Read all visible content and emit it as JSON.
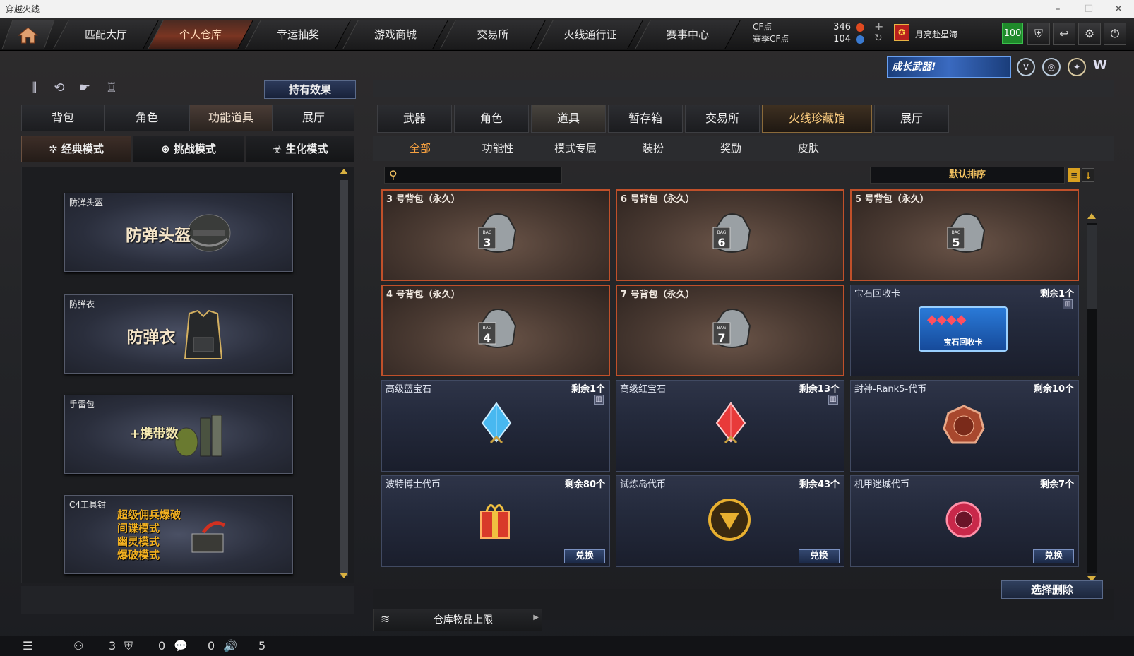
{
  "window": {
    "title": "穿越火线"
  },
  "nav": {
    "tabs": [
      {
        "label": "匹配大厅"
      },
      {
        "label": "个人仓库"
      },
      {
        "label": "幸运抽奖"
      },
      {
        "label": "游戏商城"
      },
      {
        "label": "交易所"
      },
      {
        "label": "火线通行证"
      },
      {
        "label": "赛事中心"
      }
    ],
    "cf_label": "CF点",
    "season_cf_label": "赛季CF点",
    "cf_value": "346",
    "season_cf_value": "104",
    "username": "月亮赴星海-",
    "level": "100"
  },
  "promo": {
    "banner_text": "成长武器!"
  },
  "left": {
    "effects_button": "持有效果",
    "tabs": [
      {
        "label": "背包"
      },
      {
        "label": "角色"
      },
      {
        "label": "功能道具"
      },
      {
        "label": "展厅"
      }
    ],
    "modes": [
      {
        "label": "经典模式"
      },
      {
        "label": "挑战模式"
      },
      {
        "label": "生化模式"
      }
    ],
    "items": [
      {
        "title": "防弹头盔",
        "art_text": "防弹头盔"
      },
      {
        "title": "防弹衣",
        "art_text": "防弹衣"
      },
      {
        "title": "手雷包",
        "art_text": "+携带数"
      },
      {
        "title": "C4工具钳",
        "art_lines": [
          "超级佣兵爆破",
          "间谍模式",
          "幽灵模式",
          "爆破模式"
        ]
      }
    ]
  },
  "right": {
    "tabs": [
      {
        "label": "武器"
      },
      {
        "label": "角色"
      },
      {
        "label": "道具"
      },
      {
        "label": "暂存箱"
      },
      {
        "label": "交易所"
      },
      {
        "label": "火线珍藏馆"
      },
      {
        "label": "展厅"
      }
    ],
    "subtabs": [
      {
        "label": "全部"
      },
      {
        "label": "功能性"
      },
      {
        "label": "模式专属"
      },
      {
        "label": "装扮"
      },
      {
        "label": "奖励"
      },
      {
        "label": "皮肤"
      }
    ],
    "search": {
      "placeholder": ""
    },
    "sort_label": "默认排序",
    "items": [
      {
        "name": "3 号背包（永久）",
        "bag_no": "3"
      },
      {
        "name": "6 号背包（永久）",
        "bag_no": "6"
      },
      {
        "name": "5 号背包（永久）",
        "bag_no": "5"
      },
      {
        "name": "4 号背包（永久）",
        "bag_no": "4"
      },
      {
        "name": "7 号背包（永久）",
        "bag_no": "7"
      },
      {
        "name": "宝石回收卡",
        "count": "剩余1个",
        "art_text": "宝石回收卡"
      },
      {
        "name": "高级蓝宝石",
        "count": "剩余1个"
      },
      {
        "name": "高级红宝石",
        "count": "剩余13个"
      },
      {
        "name": "封神-Rank5-代币",
        "count": "剩余10个"
      },
      {
        "name": "波特博士代币",
        "count": "剩余80个",
        "action": "兑换"
      },
      {
        "name": "试炼岛代币",
        "count": "剩余43个",
        "action": "兑换"
      },
      {
        "name": "机甲迷城代币",
        "count": "剩余7个",
        "action": "兑换"
      }
    ],
    "bag_text": "BAG",
    "delete_button": "选择删除",
    "capacity_label": "仓库物品上限"
  },
  "status": {
    "friends": "3",
    "guild": "0",
    "messages": "0",
    "volume": "5"
  },
  "colors": {
    "accent_orange": "#c0502a",
    "gold": "#f0c060",
    "level_green": "#1f8a2b"
  }
}
